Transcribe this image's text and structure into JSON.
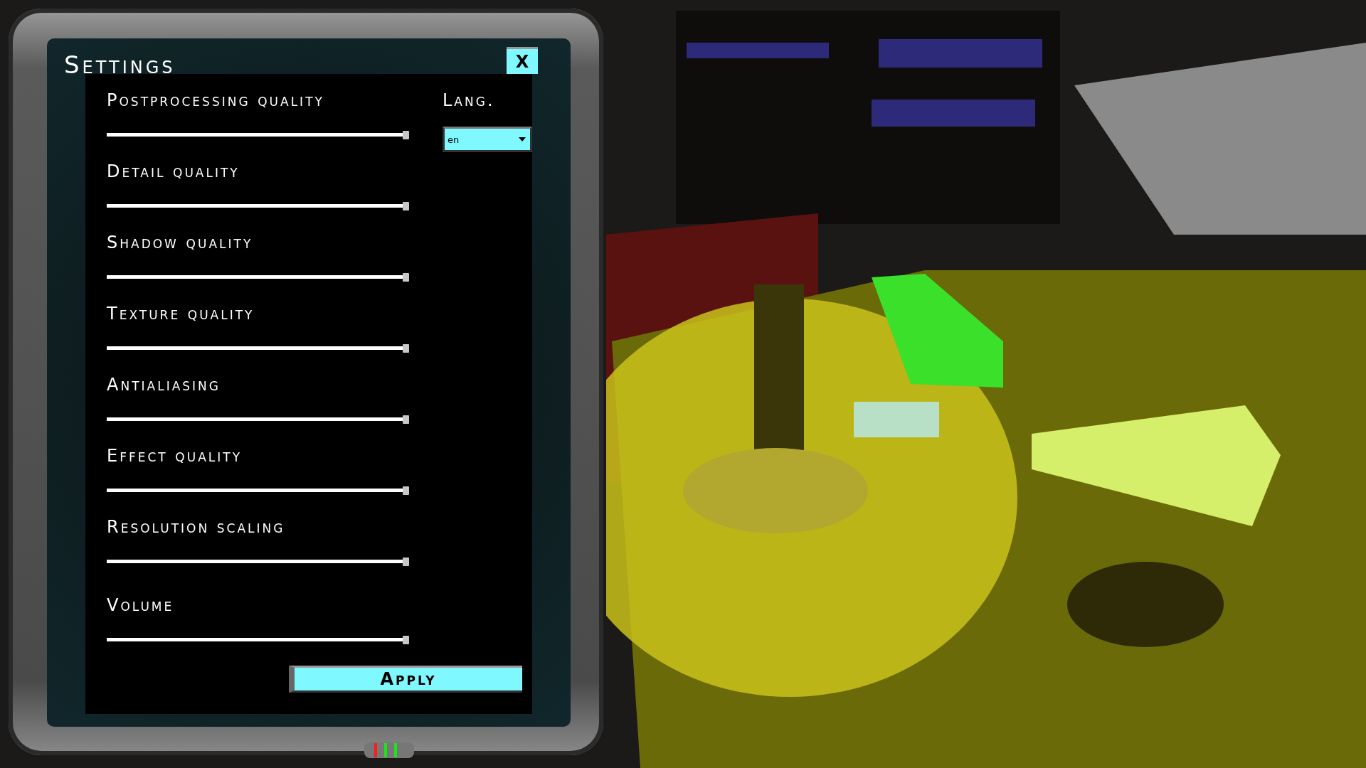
{
  "window": {
    "title": "Settings",
    "close": "X"
  },
  "sliders": [
    {
      "label": "Postprocessing quality",
      "level": 1
    },
    {
      "label": "Detail quality",
      "level": 1
    },
    {
      "label": "Shadow quality",
      "level": 1
    },
    {
      "label": "Texture quality",
      "level": 1
    },
    {
      "label": "Antialiasing",
      "level": 1
    },
    {
      "label": "Effect quality",
      "level": 1
    },
    {
      "label": "Resolution scaling",
      "level": 1
    },
    {
      "label": "Volume",
      "level": 1
    }
  ],
  "language": {
    "label": "Lang.",
    "value": "en"
  },
  "apply_button": "Apply",
  "indicator_lights": [
    {
      "color": "#ff1a1a"
    },
    {
      "color": "#19e619"
    },
    {
      "color": "#19e619"
    }
  ]
}
